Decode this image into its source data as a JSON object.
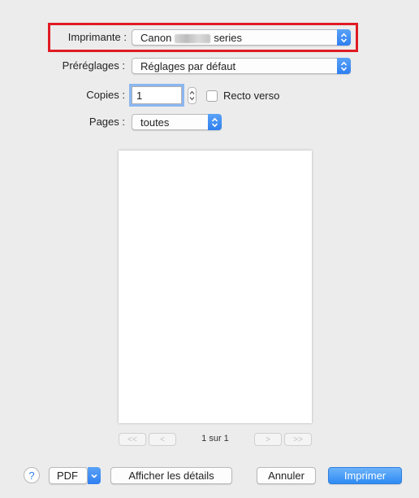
{
  "printer": {
    "label": "Imprimante :",
    "value_prefix": "Canon",
    "value_suffix": "series"
  },
  "presets": {
    "label": "Préréglages :",
    "value": "Réglages par défaut"
  },
  "copies": {
    "label": "Copies :",
    "value": "1",
    "duplex_label": "Recto verso"
  },
  "pages": {
    "label": "Pages :",
    "value": "toutes"
  },
  "preview": {
    "nav_first": "<<",
    "nav_prev": "<",
    "nav_next": ">",
    "nav_last": ">>",
    "page_indicator": "1 sur 1"
  },
  "footer": {
    "help": "?",
    "pdf": "PDF",
    "details": "Afficher les détails",
    "cancel": "Annuler",
    "print": "Imprimer"
  },
  "colors": {
    "highlight": "#e01b24",
    "accent": "#2f7ff0"
  }
}
